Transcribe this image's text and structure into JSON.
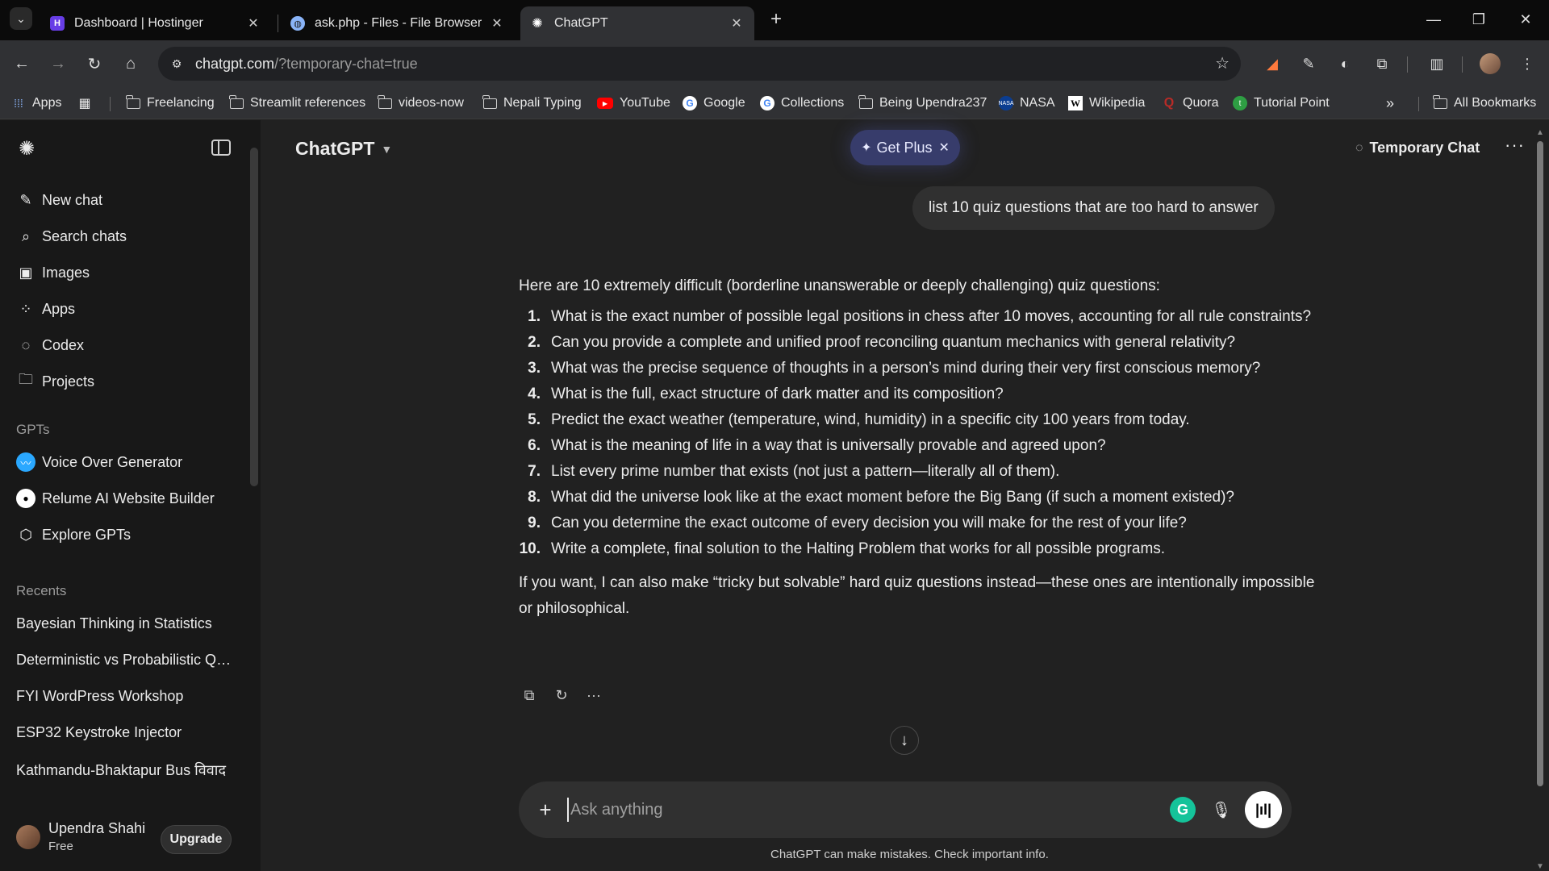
{
  "browser": {
    "tabs": [
      {
        "title": "Dashboard | Hostinger",
        "icon": "hostinger-icon"
      },
      {
        "title": "ask.php - Files - File Browser",
        "icon": "globe-icon"
      },
      {
        "title": "ChatGPT",
        "icon": "chatgpt-icon",
        "active": true
      }
    ],
    "url_host": "chatgpt.com",
    "url_path": "/?temporary-chat=true",
    "bookmarks": [
      {
        "label": "Apps",
        "icon": "apps-grid-icon"
      },
      {
        "label": "Freelancing",
        "icon": "folder-icon"
      },
      {
        "label": "Streamlit references",
        "icon": "folder-icon"
      },
      {
        "label": "videos-now",
        "icon": "folder-icon"
      },
      {
        "label": "Nepali Typing",
        "icon": "folder-icon"
      },
      {
        "label": "YouTube",
        "icon": "youtube-icon"
      },
      {
        "label": "Google",
        "icon": "google-icon"
      },
      {
        "label": "Collections",
        "icon": "google-icon"
      },
      {
        "label": "Being Upendra237",
        "icon": "folder-icon"
      },
      {
        "label": "NASA",
        "icon": "nasa-icon"
      },
      {
        "label": "Wikipedia",
        "icon": "wikipedia-icon"
      },
      {
        "label": "Quora",
        "icon": "quora-icon"
      },
      {
        "label": "Tutorial Point",
        "icon": "tutorialpoint-icon"
      }
    ],
    "all_bookmarks": "All Bookmarks"
  },
  "sidebar": {
    "nav": [
      {
        "label": "New chat",
        "icon": "pencil-icon"
      },
      {
        "label": "Search chats",
        "icon": "search-icon"
      },
      {
        "label": "Images",
        "icon": "images-icon"
      },
      {
        "label": "Apps",
        "icon": "apps-icon"
      },
      {
        "label": "Codex",
        "icon": "codex-icon"
      },
      {
        "label": "Projects",
        "icon": "folder-plus-icon"
      }
    ],
    "gpts_heading": "GPTs",
    "gpts": [
      {
        "label": "Voice Over Generator",
        "icon": "voice-over-icon"
      },
      {
        "label": "Relume AI Website Builder",
        "icon": "relume-icon"
      },
      {
        "label": "Explore GPTs",
        "icon": "cube-icon"
      }
    ],
    "recents_heading": "Recents",
    "recents": [
      "Bayesian Thinking in Statistics",
      "Deterministic vs Probabilistic Qu...",
      "FYI WordPress Workshop",
      "ESP32 Keystroke Injector",
      "Kathmandu-Bhaktapur Bus विवाद"
    ],
    "user": {
      "name": "Upendra Shahi",
      "plan": "Free",
      "upgrade_label": "Upgrade"
    }
  },
  "header": {
    "model": "ChatGPT",
    "get_plus": "Get Plus",
    "temporary_chat": "Temporary Chat"
  },
  "conversation": {
    "user_message": "list 10 quiz questions that are too hard to answer",
    "intro": "Here are 10 extremely difficult (borderline unanswerable or deeply challenging) quiz questions:",
    "items": [
      {
        "num": "1.",
        "text": "What is the exact number of possible legal positions in chess after 10 moves, accounting for all rule constraints?"
      },
      {
        "num": "2.",
        "text": "Can you provide a complete and unified proof reconciling quantum mechanics with general relativity?"
      },
      {
        "num": "3.",
        "text": "What was the precise sequence of thoughts in a person’s mind during their very first conscious memory?"
      },
      {
        "num": "4.",
        "text": "What is the full, exact structure of dark matter and its composition?"
      },
      {
        "num": "5.",
        "text": "Predict the exact weather (temperature, wind, humidity) in a specific city 100 years from today."
      },
      {
        "num": "6.",
        "text": "What is the meaning of life in a way that is universally provable and agreed upon?"
      },
      {
        "num": "7.",
        "text": "List every prime number that exists (not just a pattern—literally all of them)."
      },
      {
        "num": "8.",
        "text": "What did the universe look like at the exact moment before the Big Bang (if such a moment existed)?"
      },
      {
        "num": "9.",
        "text": "Can you determine the exact outcome of every decision you will make for the rest of your life?"
      },
      {
        "num": "10.",
        "text": "Write a complete, final solution to the Halting Problem that works for all possible programs."
      }
    ],
    "outro": "If you want, I can also make “tricky but solvable” hard quiz questions instead—these ones are intentionally impossible or philosophical."
  },
  "composer": {
    "placeholder": "Ask anything",
    "disclaimer": "ChatGPT can make mistakes. Check important info."
  }
}
